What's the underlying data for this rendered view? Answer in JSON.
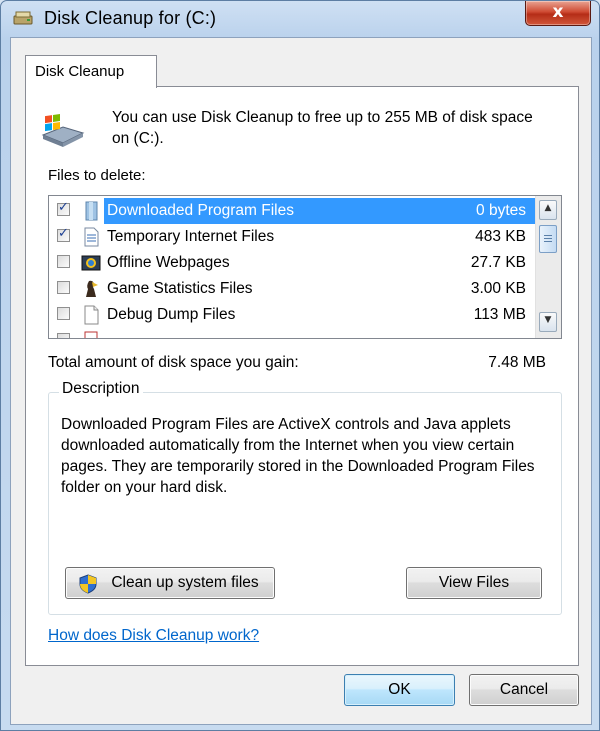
{
  "window": {
    "title": "Disk Cleanup for  (C:)",
    "close_label": "x"
  },
  "tab": {
    "label": "Disk Cleanup"
  },
  "intro": {
    "text": "You can use Disk Cleanup to free up to 255 MB of disk space on  (C:)."
  },
  "files_label": "Files to delete:",
  "files": [
    {
      "name": "Downloaded Program Files",
      "size": "0 bytes",
      "checked": true,
      "selected": true,
      "icon": "folder-icon"
    },
    {
      "name": "Temporary Internet Files",
      "size": "483 KB",
      "checked": true,
      "selected": false,
      "icon": "document-icon"
    },
    {
      "name": "Offline Webpages",
      "size": "27.7 KB",
      "checked": false,
      "selected": false,
      "icon": "offline-webpage-icon"
    },
    {
      "name": "Game Statistics Files",
      "size": "3.00 KB",
      "checked": false,
      "selected": false,
      "icon": "game-statistics-icon"
    },
    {
      "name": "Debug Dump Files",
      "size": "113 MB",
      "checked": false,
      "selected": false,
      "icon": "blank-file-icon"
    }
  ],
  "total": {
    "label": "Total amount of disk space you gain:",
    "value": "7.48 MB"
  },
  "description": {
    "title": "Description",
    "text": "Downloaded Program Files are ActiveX controls and Java applets downloaded automatically from the Internet when you view certain pages. They are temporarily stored in the Downloaded Program Files folder on your hard disk."
  },
  "buttons": {
    "cleanup": "Clean up system files",
    "view_files": "View Files",
    "ok": "OK",
    "cancel": "Cancel"
  },
  "help_link": "How does Disk Cleanup work?",
  "colors": {
    "selection": "#3399ff",
    "link": "#0066cc",
    "close_button": "#c7432b"
  }
}
